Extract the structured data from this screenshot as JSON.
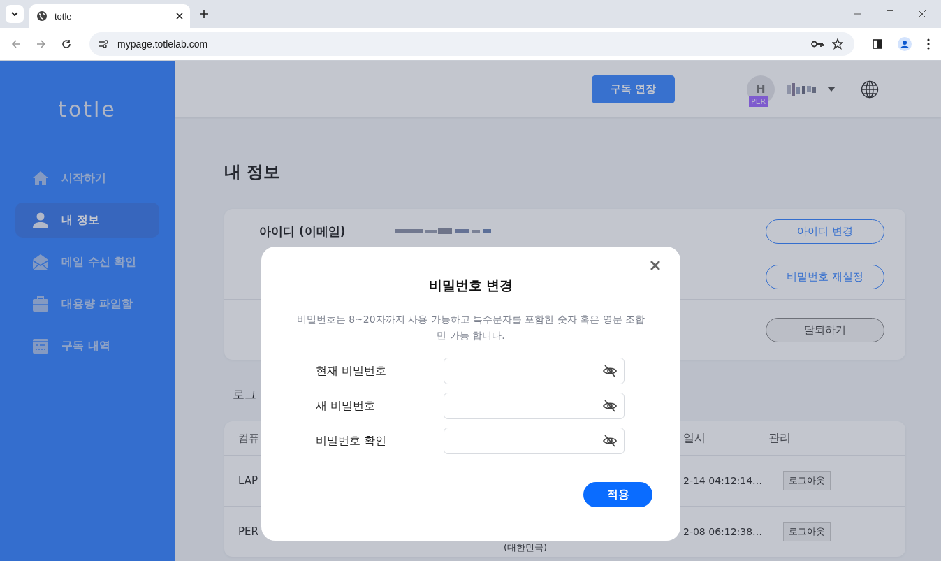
{
  "browser": {
    "tab_title": "totle",
    "url": "mypage.totlelab.com"
  },
  "sidebar": {
    "logo": "totle",
    "items": [
      {
        "label": "시작하기",
        "kind": "home",
        "selected": false
      },
      {
        "label": "내 정보",
        "kind": "person",
        "selected": true
      },
      {
        "label": "메일 수신 확인",
        "kind": "mail",
        "selected": false
      },
      {
        "label": "대용량 파일함",
        "kind": "briefcase",
        "selected": false
      },
      {
        "label": "구독 내역",
        "kind": "card",
        "selected": false
      }
    ]
  },
  "header": {
    "subscribe_button": "구독 연장",
    "avatar_letter": "H",
    "badge": "PER"
  },
  "page_title": "내 정보",
  "info_rows": [
    {
      "label": "아이디 (이메일)",
      "button": "아이디 변경",
      "kind": "primary"
    },
    {
      "button": "비밀번호 재설정",
      "kind": "primary"
    },
    {
      "button": "탈퇴하기",
      "kind": "neutral"
    }
  ],
  "login_section_title": "로그",
  "table": {
    "columns": [
      "컴퓨",
      "일시",
      "관리"
    ],
    "rows": [
      {
        "device": "LAP",
        "date": "2-14 04:12:14…",
        "action": "로그아웃"
      },
      {
        "device": "PER",
        "location": "(대한민국)",
        "date": "2-08 06:12:38…",
        "action": "로그아웃"
      }
    ]
  },
  "modal": {
    "title": "비밀번호 변경",
    "description": "비밀번호는 8~20자까지 사용 가능하고 특수문자를 포함한 숫자 혹은 영문 조합 만 가능 합니다.",
    "fields": [
      {
        "label": "현재 비밀번호"
      },
      {
        "label": "새 비밀번호"
      },
      {
        "label": "비밀번호 확인"
      }
    ],
    "submit": "적용"
  }
}
